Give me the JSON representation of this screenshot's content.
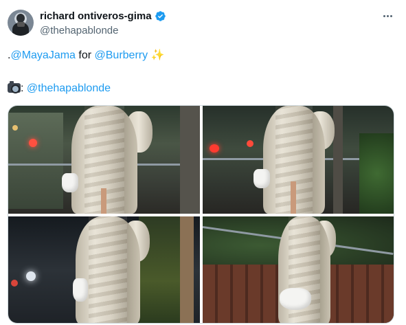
{
  "author": {
    "display_name": "richard ontiveros-gima",
    "handle": "@thehapablonde",
    "verified": true
  },
  "tweet": {
    "line1_prefix": ".",
    "mention1": "@MayaJama",
    "line1_middle": " for ",
    "mention2": "@Burberry",
    "line1_emoji": "✨",
    "line2_suffix": ": ",
    "mention3": "@thehapablonde"
  },
  "icons": {
    "verified": "verified-badge-icon",
    "more": "more-options-icon",
    "sparkles": "sparkles-icon",
    "camera": "camera-icon"
  },
  "colors": {
    "link": "#1d9bf0",
    "verified": "#1d9bf0",
    "secondary_text": "#536471"
  },
  "media": {
    "count": 4,
    "items": [
      {
        "subject": "woman in long fur coat holding white bag, night street"
      },
      {
        "subject": "woman in long fur coat holding white bag, night street"
      },
      {
        "subject": "woman in long fur coat holding white bag, night street"
      },
      {
        "subject": "woman in long fur coat holding white bag, night street"
      }
    ]
  }
}
